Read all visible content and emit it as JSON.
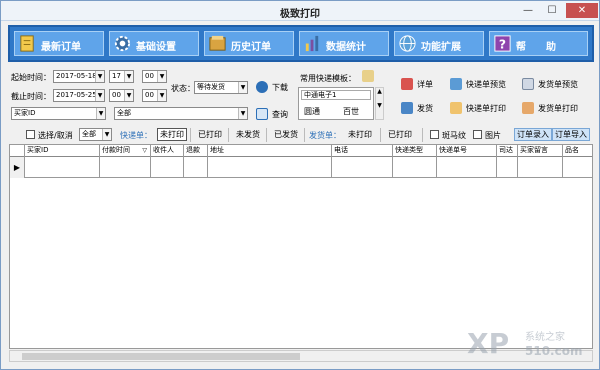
{
  "window": {
    "title": "极致打印",
    "min": "—",
    "max": "☐",
    "close": "✕"
  },
  "toolbar": [
    {
      "label": "最新订单",
      "icon": "document-icon",
      "color": "#f2c94c"
    },
    {
      "label": "基础设置",
      "icon": "gear-icon",
      "color": "#3a6ea5"
    },
    {
      "label": "历史订单",
      "icon": "history-icon",
      "color": "#d9a441"
    },
    {
      "label": "数据统计",
      "icon": "bar-chart-icon",
      "color": "#7b4fa0"
    },
    {
      "label": "功能扩展",
      "icon": "globe-icon",
      "color": "#5aa0d8"
    },
    {
      "label": "帮　　助",
      "icon": "help-icon",
      "color": "#8e44ad"
    }
  ],
  "form": {
    "start_label": "起始时间：",
    "start_date": "2017-05-18",
    "start_hour": "17",
    "start_min": "00",
    "end_label": "截止时间：",
    "end_date": "2017-05-25",
    "end_hour": "00",
    "end_min": "00",
    "status_label": "状态：",
    "status_value": "等待发货",
    "download_label": "下载",
    "buyer_field": "买家ID",
    "all_value": "全部",
    "query_label": "查询",
    "express_templates_label": "常用快递模板：",
    "template_items": [
      "中通电子1",
      "圆通",
      "百世"
    ]
  },
  "actions": [
    {
      "label": "详单",
      "icon": "detail-icon"
    },
    {
      "label": "快递单预览",
      "icon": "preview-icon"
    },
    {
      "label": "发货单预览",
      "icon": "preview-icon"
    },
    {
      "label": "发货",
      "icon": "ship-icon"
    },
    {
      "label": "快递单打印",
      "icon": "print-icon"
    },
    {
      "label": "发货单打印",
      "icon": "print-icon"
    }
  ],
  "filter": {
    "select_label": "选择/取消",
    "select_all": "全部",
    "express_label": "快递单：",
    "express_opts": [
      "未打印",
      "已打印",
      "未发货",
      "已发货"
    ],
    "ship_label": "发货单：",
    "ship_opts": [
      "未打印",
      "已打印"
    ],
    "barcode_label": "斑马纹",
    "image_label": "图片",
    "import_order": "订单录入",
    "import_file": "订单导入"
  },
  "grid": {
    "columns": [
      "买家ID",
      "付款时间",
      "收件人",
      "退款",
      "地址",
      "电话",
      "快递类型",
      "快递单号",
      "司达",
      "买家留言",
      "品名"
    ],
    "sort_mark": "▽",
    "row_marker": "▶"
  },
  "watermark": {
    "text": "XP",
    "sub": "系统之家",
    "num": "510.com"
  }
}
